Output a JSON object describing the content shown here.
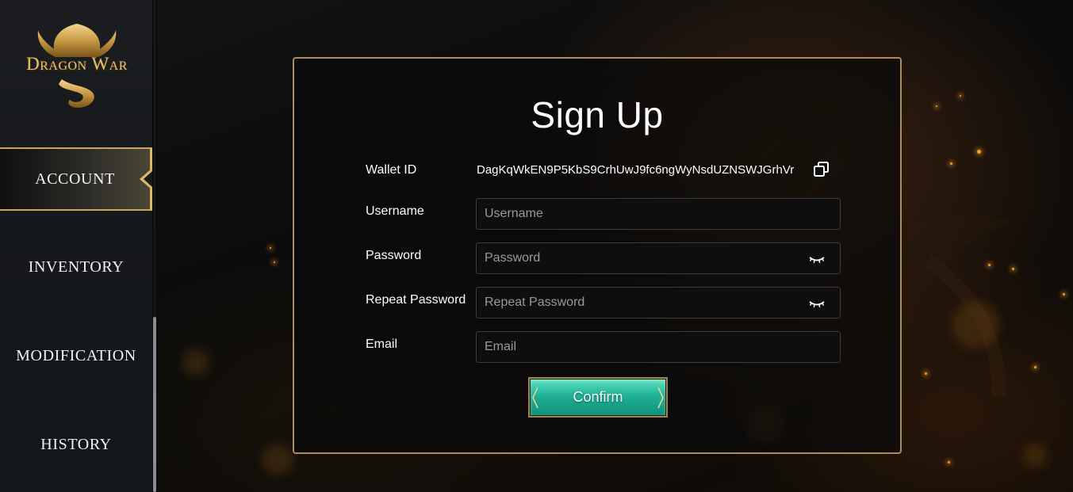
{
  "brand": {
    "logo_text": "Dragon War"
  },
  "sidebar": {
    "items": [
      {
        "label": "ACCOUNT",
        "active": true
      },
      {
        "label": "INVENTORY",
        "active": false
      },
      {
        "label": "MODIFICATION",
        "active": false
      },
      {
        "label": "HISTORY",
        "active": false
      }
    ]
  },
  "signup": {
    "title": "Sign Up",
    "wallet_label": "Wallet ID",
    "wallet_value": "DagKqWkEN9P5KbS9CrhUwJ9fc6ngWyNsdUZNSWJGrhVr",
    "username_label": "Username",
    "username_placeholder": "Username",
    "username_value": "",
    "password_label": "Password",
    "password_placeholder": "Password",
    "password_value": "",
    "repeat_label": "Repeat Password",
    "repeat_placeholder": "Repeat Password",
    "repeat_value": "",
    "email_label": "Email",
    "email_placeholder": "Email",
    "email_value": "",
    "confirm_label": "Confirm"
  },
  "icons": {
    "copy": "copy-icon",
    "eye_closed": "eye-closed-icon"
  },
  "colors": {
    "accent_gold": "#c9a35a",
    "panel_border": "#b08a5a",
    "button_teal": "#1fb396"
  }
}
